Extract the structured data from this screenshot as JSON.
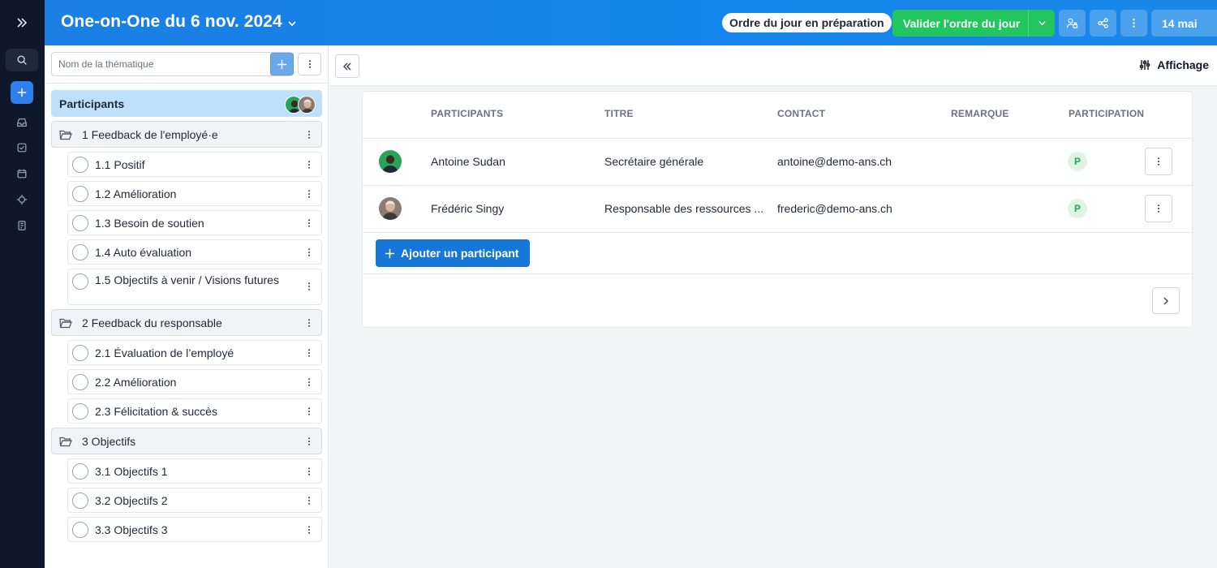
{
  "header": {
    "title": "One-on-One du 6 nov. 2024",
    "status": "Ordre du jour en préparation",
    "validate_label": "Valider l'ordre du jour",
    "date_label": "14 mai"
  },
  "sidebar": {
    "search_placeholder": "Nom de la thématique",
    "participants_label": "Participants",
    "groups": [
      {
        "label": "1  Feedback de l'employé·e",
        "items": [
          {
            "label": "1.1  Positif"
          },
          {
            "label": "1.2  Amélioration"
          },
          {
            "label": "1.3  Besoin de soutien"
          },
          {
            "label": "1.4  Auto évaluation"
          },
          {
            "label": "1.5  Objectifs à venir / Visions futures"
          }
        ]
      },
      {
        "label": "2  Feedback du responsable",
        "items": [
          {
            "label": "2.1  Évaluation de l’employé"
          },
          {
            "label": "2.2  Amélioration"
          },
          {
            "label": "2.3  Félicitation & succès"
          }
        ]
      },
      {
        "label": "3  Objectifs",
        "items": [
          {
            "label": "3.1  Objectifs 1"
          },
          {
            "label": "3.2  Objectifs 2"
          },
          {
            "label": "3.3  Objectifs 3"
          }
        ]
      }
    ]
  },
  "main": {
    "display_label": "Affichage",
    "table": {
      "headers": [
        "PARTICIPANTS",
        "TITRE",
        "CONTACT",
        "REMARQUE",
        "PARTICIPATION"
      ],
      "rows": [
        {
          "name": "Antoine Sudan",
          "title": "Secrétaire générale",
          "contact": "antoine@demo-ans.ch",
          "remark": "",
          "participation": "P"
        },
        {
          "name": "Frédéric Singy",
          "title": "Responsable des ressources ...",
          "contact": "frederic@demo-ans.ch",
          "remark": "",
          "participation": "P"
        }
      ]
    },
    "add_participant_label": "Ajouter un participant"
  },
  "colors": {
    "header_blue": "#1b7fe4",
    "validate_green": "#22c55e",
    "participants_highlight": "#bfe0fb",
    "rail_bg": "#0f172a"
  }
}
